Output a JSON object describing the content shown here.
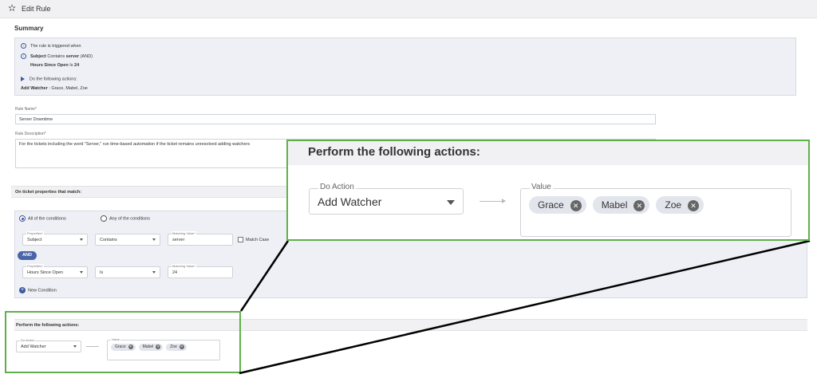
{
  "header": {
    "title": "Edit Rule",
    "icon": "star-gear-icon"
  },
  "summary": {
    "heading": "Summary",
    "trigger_text": "The rule is triggered when",
    "cond1": {
      "field": "Subject",
      "operator": "Contains",
      "value": "server",
      "join": "(AND)"
    },
    "cond2": {
      "field": "Hours Since Open",
      "operator": "Is",
      "value": "24"
    },
    "actions_text": "Do the following actions:",
    "action": {
      "name": "Add Watcher",
      "sep": " : ",
      "values": "Grace, Mabel, Zoe"
    }
  },
  "rule_name": {
    "label": "Rule Name*",
    "value": "Server Downtime"
  },
  "rule_description": {
    "label": "Rule Description*",
    "value": "For the tickets including the word \"Server,\" run time-based automation if the ticket remains unresolved adding watchers"
  },
  "conditions": {
    "heading": "On ticket properties that match:",
    "match_all_label": "All of the conditions",
    "match_any_label": "Any of the conditions",
    "selected": "all",
    "join_label": "AND",
    "rows": [
      {
        "property_label": "Properties*",
        "property": "Subject",
        "operator": "Contains",
        "value_label": "Matching Value*",
        "value": "server",
        "match_case_label": "Match Case"
      },
      {
        "property_label": "Properties*",
        "property": "Hours Since Open",
        "operator": "Is",
        "value_label": "Matching Value*",
        "value": "24"
      }
    ],
    "new_condition_label": "New Condition"
  },
  "actions": {
    "heading": "Perform the following actions:",
    "do_action_label": "Do Action",
    "do_action_value": "Add Watcher",
    "value_label": "Value",
    "watchers": [
      "Grace",
      "Mabel",
      "Zoe"
    ]
  },
  "colors": {
    "highlight": "#5fb04a",
    "accent": "#3d5a9e",
    "and_pill": "#4b66a8",
    "band": "#f1f1f3",
    "panel": "#eef0f5"
  }
}
